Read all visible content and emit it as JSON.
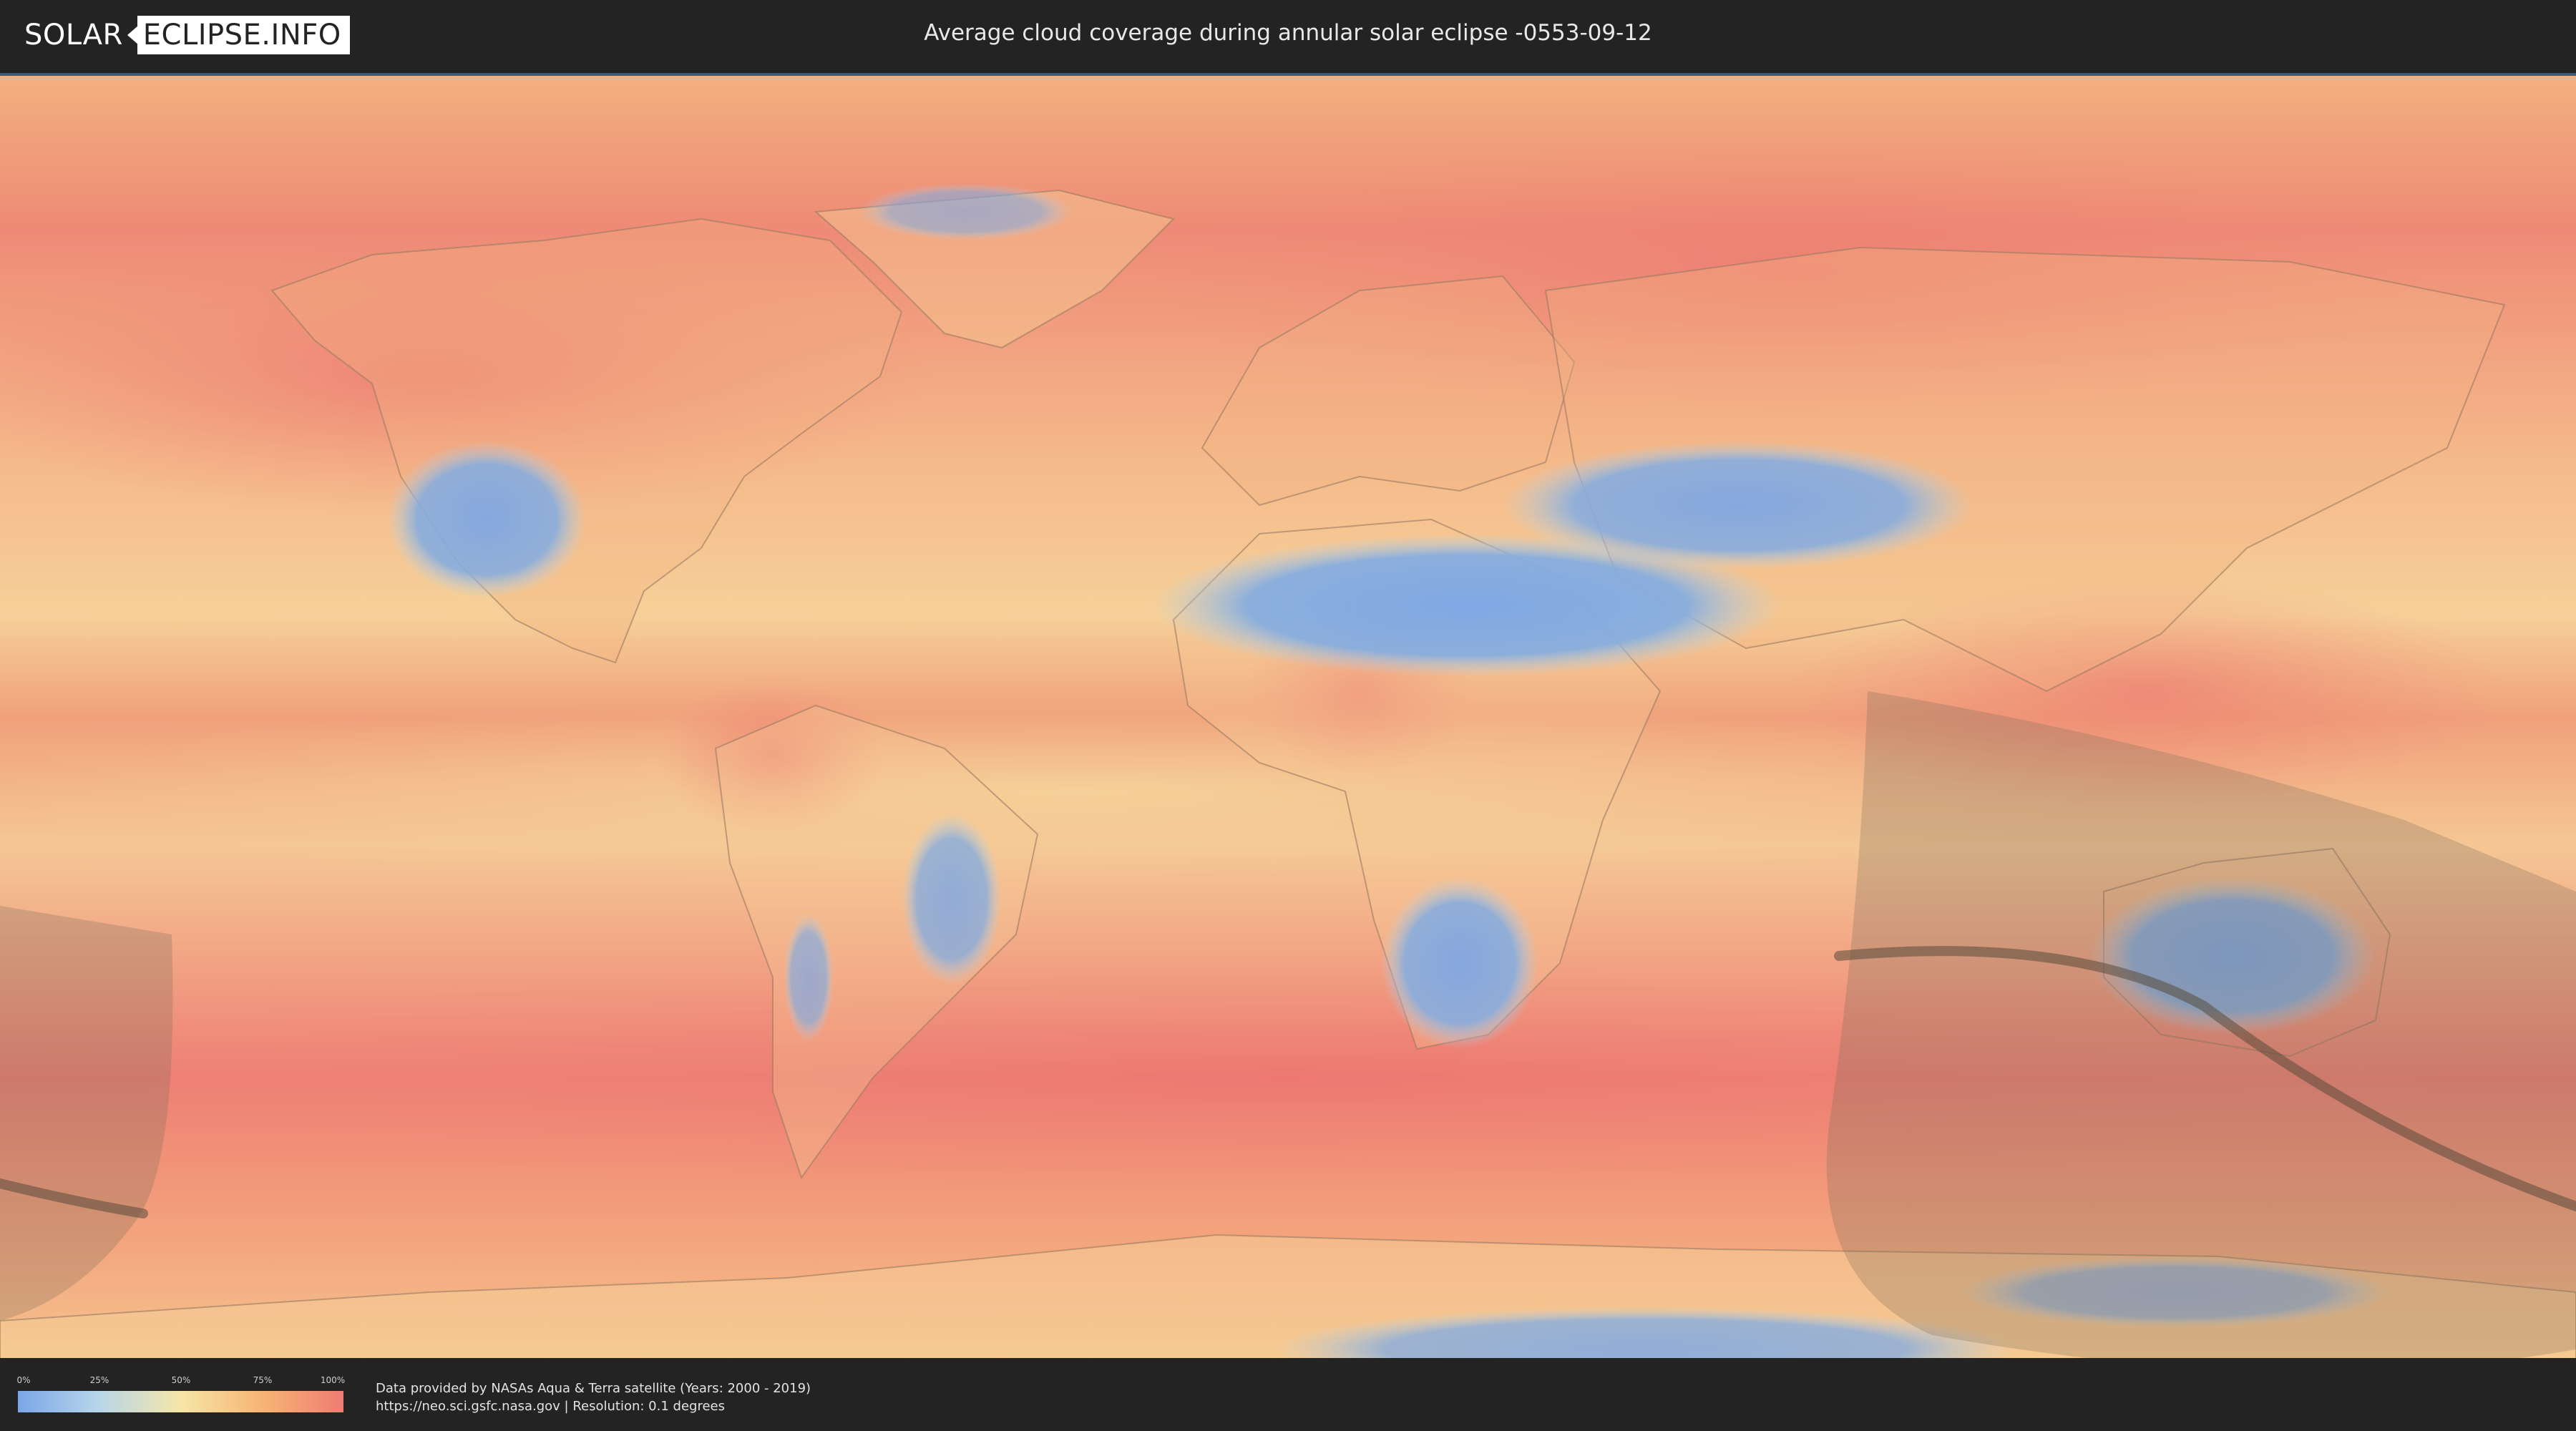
{
  "header": {
    "logo_left": "SOLAR",
    "logo_right": "ECLIPSE.INFO",
    "title": "Average cloud coverage during annular solar eclipse -0553-09-12"
  },
  "legend": {
    "ticks": [
      "0%",
      "25%",
      "50%",
      "75%",
      "100%"
    ],
    "gradient_colors": [
      "#7aa6e8",
      "#b8d6ea",
      "#f5e6a8",
      "#f6b574",
      "#ef7c74"
    ]
  },
  "credits": {
    "line1": "Data provided by NASAs Aqua & Terra satellite (Years: 2000 - 2019)",
    "line2": "https://neo.sci.gsfc.nasa.gov | Resolution: 0.1 degrees"
  },
  "colors": {
    "clear_sky": "#7aa6e8",
    "cloudy": "#ef7c74",
    "eclipse_zone": "#7a6a58",
    "central_line": "#5a4a3a"
  }
}
